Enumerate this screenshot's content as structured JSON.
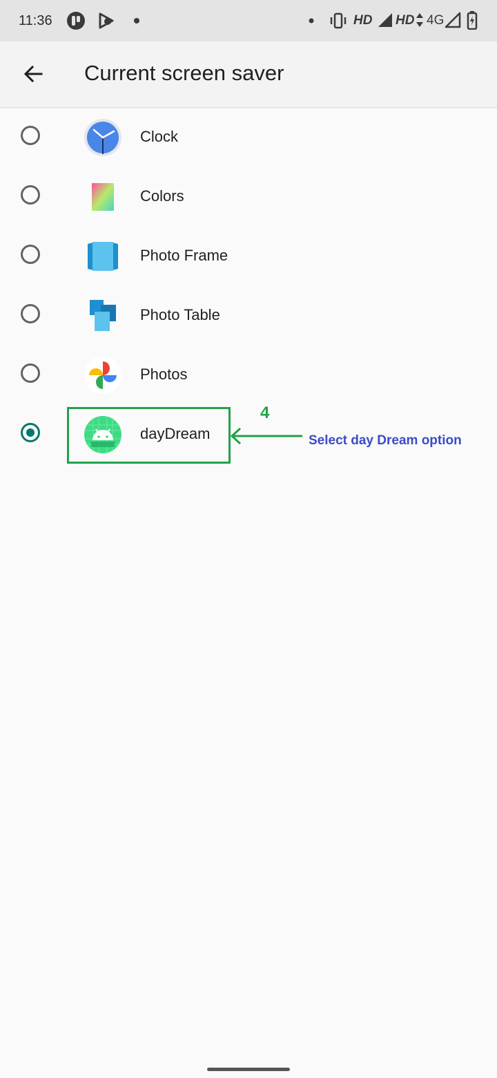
{
  "status_bar": {
    "time": "11:36",
    "left_icons": [
      "parcel-app-icon",
      "youtube-music-app-icon",
      "notification-dot-icon"
    ],
    "right_indicators": {
      "dot": "notification-dot-icon",
      "vibrate": "vibrate-icon",
      "hd_1": "HD",
      "hd_2": "HD",
      "network": "4G",
      "battery": "battery-charging-icon"
    }
  },
  "app_bar": {
    "back_icon": "arrow-back-icon",
    "title": "Current screen saver"
  },
  "screensavers": [
    {
      "label": "Clock",
      "icon": "clock-icon",
      "selected": false
    },
    {
      "label": "Colors",
      "icon": "colors-icon",
      "selected": false
    },
    {
      "label": "Photo Frame",
      "icon": "photo-frame-icon",
      "selected": false
    },
    {
      "label": "Photo Table",
      "icon": "photo-table-icon",
      "selected": false
    },
    {
      "label": "Photos",
      "icon": "google-photos-icon",
      "selected": false
    },
    {
      "label": "dayDream",
      "icon": "android-daydream-icon",
      "selected": true
    }
  ],
  "annotation": {
    "step": "4",
    "note": "Select day Dream option",
    "color": "#21a24a",
    "note_color": "#3b4bc8"
  },
  "colors": {
    "accent": "#00796b",
    "background": "#fafafa",
    "status_bar": "#e4e4e4"
  }
}
